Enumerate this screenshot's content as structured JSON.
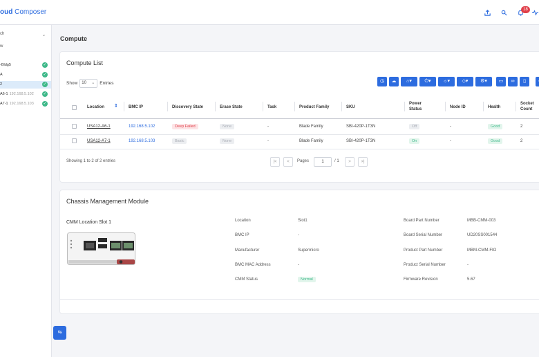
{
  "app": {
    "brand_part1": "oud",
    "brand_part2": "Composer",
    "notification_count": "18"
  },
  "sidebar": {
    "search_label": "ch",
    "view_label": "w",
    "items": [
      {
        "label": "-Bldg5",
        "ip": "",
        "selected": false,
        "checked": true
      },
      {
        "label": "A",
        "ip": "",
        "selected": false,
        "checked": true
      },
      {
        "label": "2",
        "ip": "",
        "selected": true,
        "checked": true
      },
      {
        "label": "A6-1",
        "ip": "192.168.5.102",
        "selected": false,
        "checked": true
      },
      {
        "label": "A7-1",
        "ip": "192.168.5.103",
        "selected": false,
        "checked": true
      }
    ]
  },
  "page": {
    "title": "Compute"
  },
  "compute_list": {
    "title": "Compute List",
    "show_label": "Show",
    "page_size": "10",
    "entries_label": "Entries",
    "columns": [
      "Location",
      "BMC IP",
      "Discovery State",
      "Erase State",
      "Task",
      "Product Family",
      "SKU",
      "Power Status",
      "Node ID",
      "Health",
      "Socket Count"
    ],
    "rows": [
      {
        "location": "USA12-A6-1",
        "bmc_ip": "192.168.5.102",
        "discovery": "Deep Failed",
        "erase": "None",
        "task": "-",
        "family": "Blade Family",
        "sku": "SBI-420P-1T3N",
        "power": "Off",
        "node": "-",
        "health": "Good",
        "socket": "2"
      },
      {
        "location": "USA12-A7-1",
        "bmc_ip": "192.168.5.103",
        "discovery": "Basic",
        "erase": "None",
        "task": "-",
        "family": "Blade Family",
        "sku": "SBI-420P-1T3N",
        "power": "On",
        "node": "-",
        "health": "Good",
        "socket": "2"
      }
    ],
    "footer_text": "Showing 1 to 2 of 2 entries",
    "pages_label": "Pages",
    "current_page": "1",
    "total_pages": "/ 1"
  },
  "cmm": {
    "title": "Chassis Management Module",
    "slot_title": "CMM Location Slot 1",
    "fields_left": [
      {
        "label": "Location",
        "value": "Slot1"
      },
      {
        "label": "BMC IP",
        "value": "-"
      },
      {
        "label": "Manufacturer",
        "value": "Supermicro"
      },
      {
        "label": "BMC MAC Address",
        "value": "-"
      },
      {
        "label": "CMM Status",
        "value": "Normal"
      }
    ],
    "fields_right": [
      {
        "label": "Board Part Number",
        "value": "MBB-CMM-003"
      },
      {
        "label": "Board Serial Number",
        "value": "UD20SS001544"
      },
      {
        "label": "Product Part Number",
        "value": "MBM-CMM-FIO"
      },
      {
        "label": "Product Serial Number",
        "value": "-"
      },
      {
        "label": "Firmware Revision",
        "value": "5.67"
      }
    ]
  },
  "colors": {
    "accent": "#2d6cdf",
    "success": "#3fb98a",
    "danger": "#e0404a"
  }
}
